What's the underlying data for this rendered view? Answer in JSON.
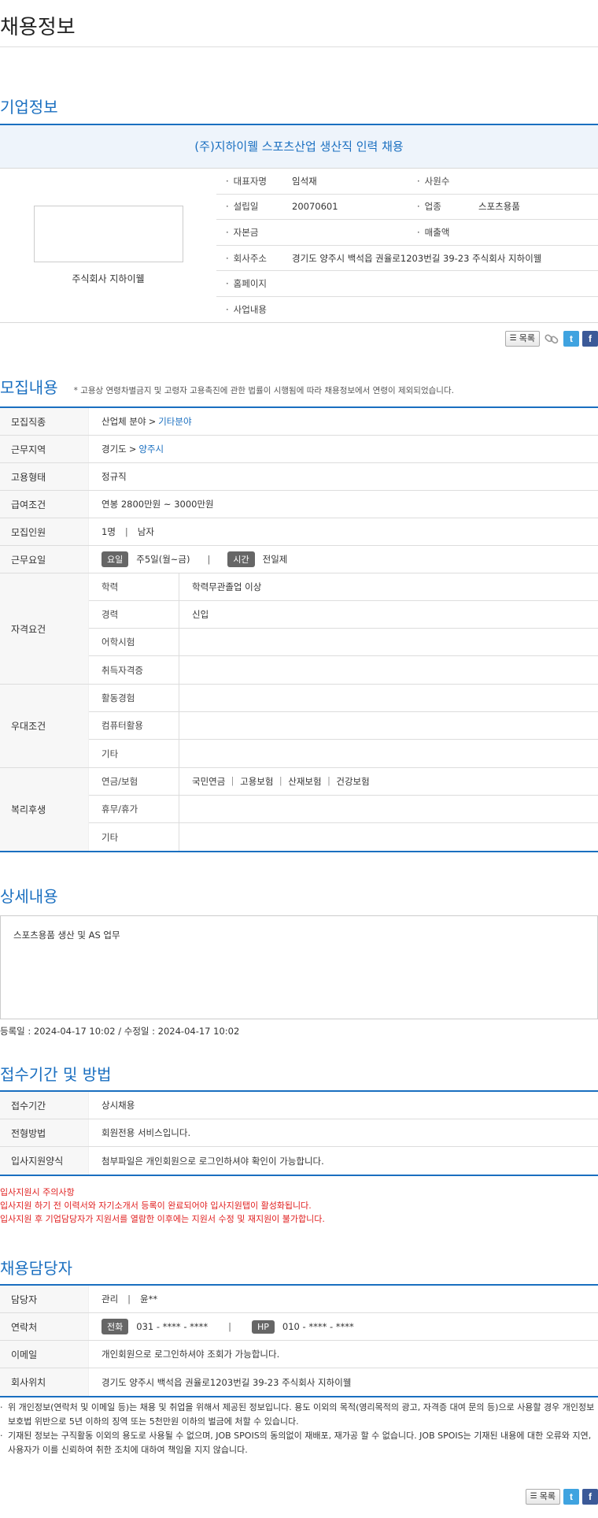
{
  "page_title": "채용정보",
  "company_section": {
    "title": "기업정보",
    "company_name": "(주)지하이웰 스포츠산업 생산직 인력 채용",
    "logo_caption": "주식회사 지하이웰",
    "rows": [
      {
        "l1": "대표자명",
        "v1": "임석재",
        "l2": "사원수",
        "v2": ""
      },
      {
        "l1": "설립일",
        "v1": "20070601",
        "l2": "업종",
        "v2": "스포츠용품"
      },
      {
        "l1": "자본금",
        "v1": "",
        "l2": "매출액",
        "v2": ""
      }
    ],
    "address_label": "회사주소",
    "address": "경기도 양주시 백석읍 권율로1203번길 39-23 주식회사 지하이웰",
    "homepage_label": "홈페이지",
    "homepage": "",
    "business_label": "사업내용",
    "business": ""
  },
  "toolbar": {
    "list_label": "목록",
    "twitter": "t",
    "facebook": "f"
  },
  "recruit": {
    "title": "모집내용",
    "note": "* 고용상 연령차별금지 및 고령자 고용촉진에 관한 법률이 시행됨에 따라 채용정보에서 연령이 제외되었습니다.",
    "job_label": "모집직종",
    "job_cat": "산업체 분야",
    "job_sub": "기타분야",
    "area_label": "근무지역",
    "area_prov": "경기도",
    "area_city": "양주시",
    "type_label": "고용형태",
    "type": "정규직",
    "pay_label": "급여조건",
    "pay": "연봉 2800만원 ~ 3000만원",
    "people_label": "모집인원",
    "people_count": "1명",
    "people_gender": "남자",
    "days_label": "근무요일",
    "day_badge": "요일",
    "days": "주5일(월~금)",
    "time_badge": "시간",
    "time": "전일제",
    "qual_label": "자격요건",
    "qual_rows": [
      {
        "label": "학력",
        "value": "학력무관졸업 이상"
      },
      {
        "label": "경력",
        "value": "신입"
      },
      {
        "label": "어학시험",
        "value": ""
      },
      {
        "label": "취득자격증",
        "value": ""
      }
    ],
    "pref_label": "우대조건",
    "pref_rows": [
      {
        "label": "활동경험",
        "value": ""
      },
      {
        "label": "컴퓨터활용",
        "value": ""
      },
      {
        "label": "기타",
        "value": ""
      }
    ],
    "welfare_label": "복리후생",
    "welfare_rows": [
      {
        "label": "연금/보험",
        "value": "국민연금 ｜ 고용보험 ｜ 산재보험 ｜ 건강보험"
      },
      {
        "label": "휴무/휴가",
        "value": ""
      },
      {
        "label": "기타",
        "value": ""
      }
    ]
  },
  "detail": {
    "title": "상세내용",
    "text": "스포츠용품 생산 및 AS 업무",
    "dates": "등록일 : 2024-04-17 10:02 / 수정일 : 2024-04-17 10:02"
  },
  "apply": {
    "title": "접수기간 및 방법",
    "rows": [
      {
        "label": "접수기간",
        "value": "상시채용"
      },
      {
        "label": "전형방법",
        "value": "회원전용 서비스입니다."
      },
      {
        "label": "입사지원양식",
        "value": "첨부파일은 개인회원으로 로그인하셔야 확인이 가능합니다."
      }
    ],
    "warn_title": "입사지원시 주의사항",
    "warn1": "입사지원 하기 전 이력서와 자기소개서 등록이 완료되어야 입사지원탭이 활성화됩니다.",
    "warn2": "입사지원 후 기업담당자가 지원서를 열람한 이후에는 지원서 수정 및 재지원이 불가합니다."
  },
  "contact": {
    "title": "채용담당자",
    "person_label": "담당자",
    "dept": "관리",
    "name": "윤**",
    "phone_label": "연락처",
    "tel_badge": "전화",
    "tel": "031 - **** - ****",
    "hp_badge": "HP",
    "hp": "010 - **** - ****",
    "email_label": "이메일",
    "email": "개인회원으로 로그인하셔야 조회가 가능합니다.",
    "loc_label": "회사위치",
    "loc": "경기도 양주시 백석읍 권율로1203번길 39-23 주식회사 지하이웰"
  },
  "footer_notes": [
    "위 개인정보(연락처 및 이메일 등)는 채용 및 취업을 위해서 제공된 정보입니다. 용도 이외의 목적(영리목적의 광고, 자격증 대여 문의 등)으로 사용할 경우 개인정보보호법 위반으로 5년 이하의 징역 또는 5천만원 이하의 벌금에 처할 수 있습니다.",
    "기재된 정보는 구직활동 이외의 용도로 사용될 수 없으며, JOB SPOIS의 동의없이 재배포, 재가공 할 수 없습니다. JOB SPOIS는 기재된 내용에 대한 오류와 지연, 사용자가 이를 신뢰하여 취한 조치에 대하여 책임을 지지 않습니다."
  ]
}
